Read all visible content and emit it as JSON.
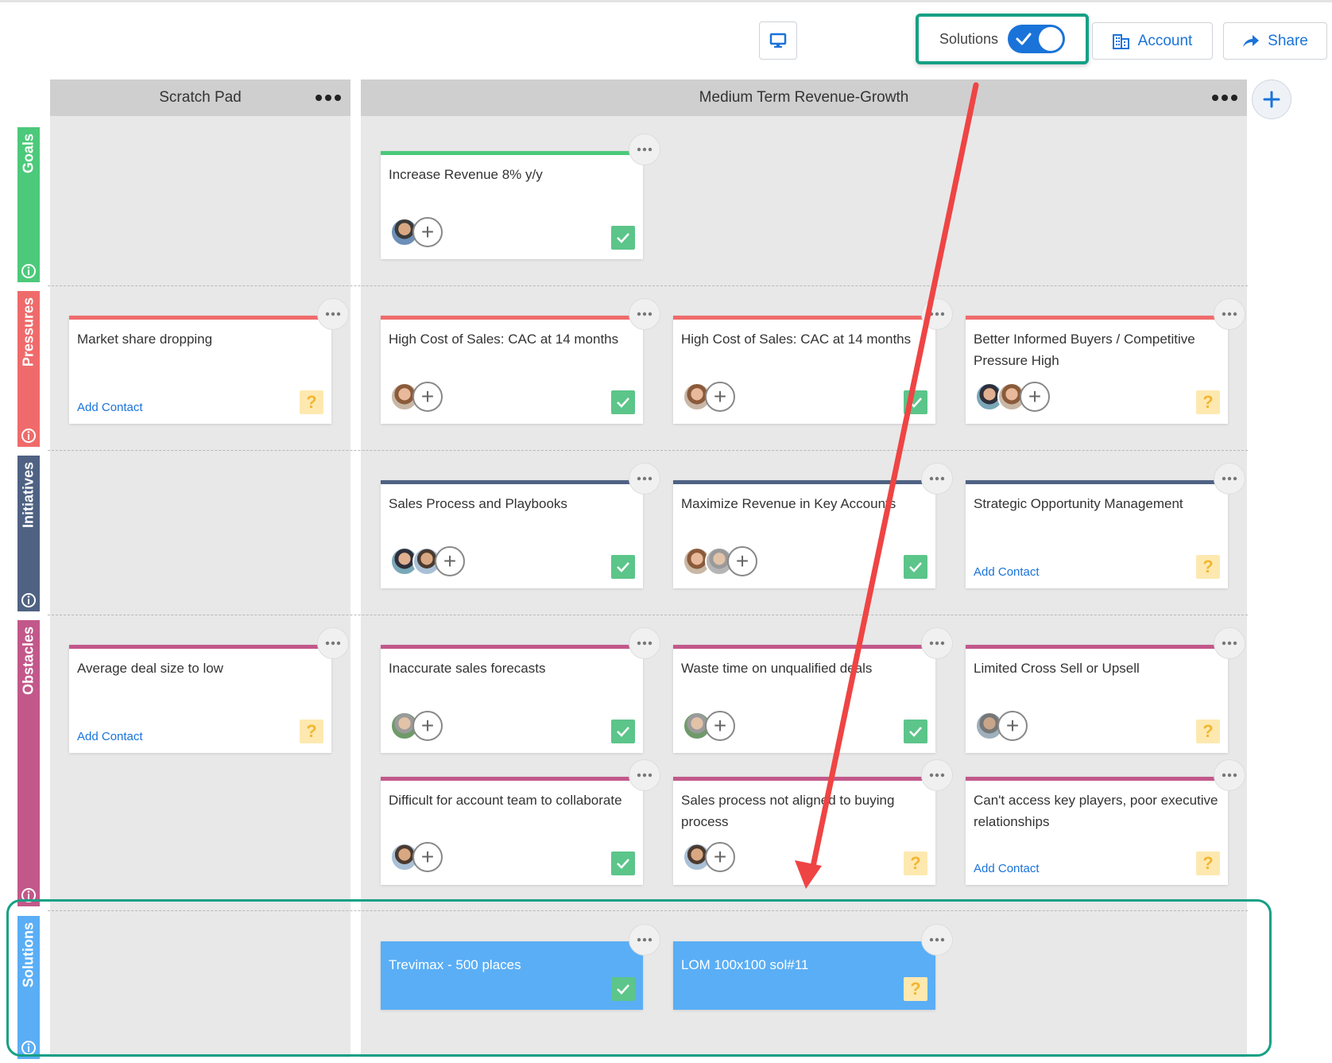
{
  "toolbar": {
    "present_icon": "monitor-icon",
    "solutions_toggle_label": "Solutions",
    "solutions_toggle_on": true,
    "account_label": "Account",
    "account_icon": "building-icon",
    "share_label": "Share",
    "share_icon": "share-arrow-icon"
  },
  "rows": [
    {
      "label": "Goals",
      "color": "#4cc97a"
    },
    {
      "label": "Pressures",
      "color": "#ef6b6b"
    },
    {
      "label": "Initiatives",
      "color": "#4f6283"
    },
    {
      "label": "Obstacles",
      "color": "#c2588a"
    },
    {
      "label": "Solutions",
      "color": "#5aaef5"
    }
  ],
  "columns": [
    {
      "title": "Scratch Pad"
    },
    {
      "title": "Medium Term Revenue-Growth"
    }
  ],
  "add_column_icon": "plus-icon",
  "cards": {
    "scratch_pressure": {
      "title": "Market share dropping",
      "add_contact": "Add Contact",
      "status": "?"
    },
    "scratch_obstacle": {
      "title": "Average deal size to low",
      "add_contact": "Add Contact",
      "status": "?"
    },
    "goal_1": {
      "title": "Increase Revenue 8% y/y"
    },
    "pressure_1": {
      "title": "High Cost of Sales: CAC at 14 months"
    },
    "pressure_2": {
      "title": "High Cost of Sales: CAC at 14 months"
    },
    "pressure_3": {
      "title": "Better Informed Buyers / Competitive Pressure High",
      "status": "?"
    },
    "initiative_1": {
      "title": "Sales Process and Playbooks"
    },
    "initiative_2": {
      "title": "Maximize Revenue in Key Accounts"
    },
    "initiative_3": {
      "title": "Strategic Opportunity Management",
      "add_contact": "Add Contact",
      "status": "?"
    },
    "obstacle_1": {
      "title": "Inaccurate sales forecasts"
    },
    "obstacle_2": {
      "title": "Waste time on unqualified deals"
    },
    "obstacle_3": {
      "title": "Limited Cross Sell or Upsell",
      "status": "?"
    },
    "obstacle_4": {
      "title": "Difficult for account team to collaborate"
    },
    "obstacle_5": {
      "title": "Sales process not aligned to buying process",
      "status": "?"
    },
    "obstacle_6": {
      "title": "Can't access key players, poor executive relationships",
      "add_contact": "Add Contact",
      "status": "?"
    },
    "solution_1": {
      "title": "Trevimax - 500 places"
    },
    "solution_2": {
      "title": "LOM 100x100 sol#11",
      "status": "?"
    }
  }
}
